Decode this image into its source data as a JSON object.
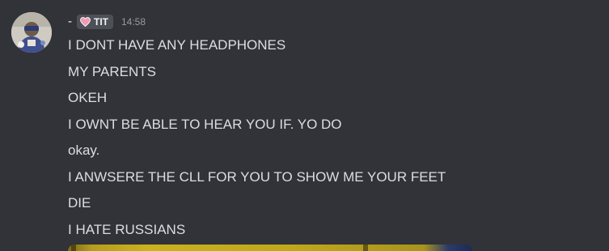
{
  "author": {
    "name": "-",
    "tag_label": "TIT",
    "tag_icon": "heart-icon",
    "tag_icon_color": "#f29bb3",
    "timestamp": "14:58"
  },
  "messages": [
    "I DONT HAVE ANY HEADPHONES",
    "MY PARENTS",
    "OKEH",
    "I OWNT BE ABLE TO HEAR YOU IF. YO DO",
    "okay.",
    "I ANWSERE THE CLL FOR YOU TO SHOW ME YOUR FEET",
    "DIE",
    "I HATE RUSSIANS"
  ],
  "colors": {
    "background": "#313338",
    "message_text": "#dbdee1",
    "timestamp_text": "#949ba4",
    "tag_background": "#4e5058"
  }
}
